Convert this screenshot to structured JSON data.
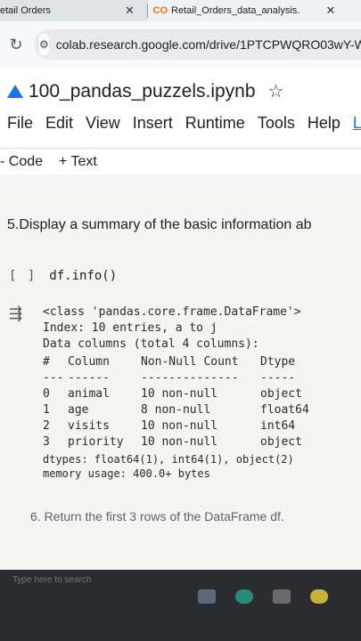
{
  "browser": {
    "tabs": [
      {
        "label": "etail Orders"
      },
      {
        "label": "Retail_Orders_data_analysis."
      }
    ],
    "close_glyph": "✕",
    "url": "colab.research.google.com/drive/1PTCPWQRO03wY-We"
  },
  "colab": {
    "logo_text": "CO",
    "notebook_title": "100_pandas_puzzels.ipynb",
    "menu": [
      "File",
      "Edit",
      "View",
      "Insert",
      "Runtime",
      "Tools",
      "Help",
      "La"
    ],
    "toolbar": {
      "code_label": "- Code",
      "text_label": "+ Text"
    }
  },
  "notebook": {
    "heading": "5.Display a summary of the basic information ab",
    "cell": {
      "brackets": "[ ]",
      "code": "df.info()"
    },
    "output": {
      "line1": "<class 'pandas.core.frame.DataFrame'>",
      "line2": "Index: 10 entries, a to j",
      "line3": "Data columns (total 4 columns):",
      "header": [
        "#",
        "Column",
        "Non-Null Count",
        "Dtype"
      ],
      "rule": [
        "---",
        "------",
        "--------------",
        "-----"
      ],
      "rows": [
        [
          "0",
          "animal",
          "10 non-null",
          "object"
        ],
        [
          "1",
          "age",
          "8 non-null",
          "float64"
        ],
        [
          "2",
          "visits",
          "10 non-null",
          "int64"
        ],
        [
          "3",
          "priority",
          "10 non-null",
          "object"
        ]
      ],
      "dtypes": "dtypes: float64(1), int64(1), object(2)",
      "memory": "memory usage: 400.0+ bytes"
    },
    "next_heading": "6. Return the first 3 rows of the DataFrame df."
  },
  "taskbar": {
    "search_placeholder": "Type here to search"
  }
}
